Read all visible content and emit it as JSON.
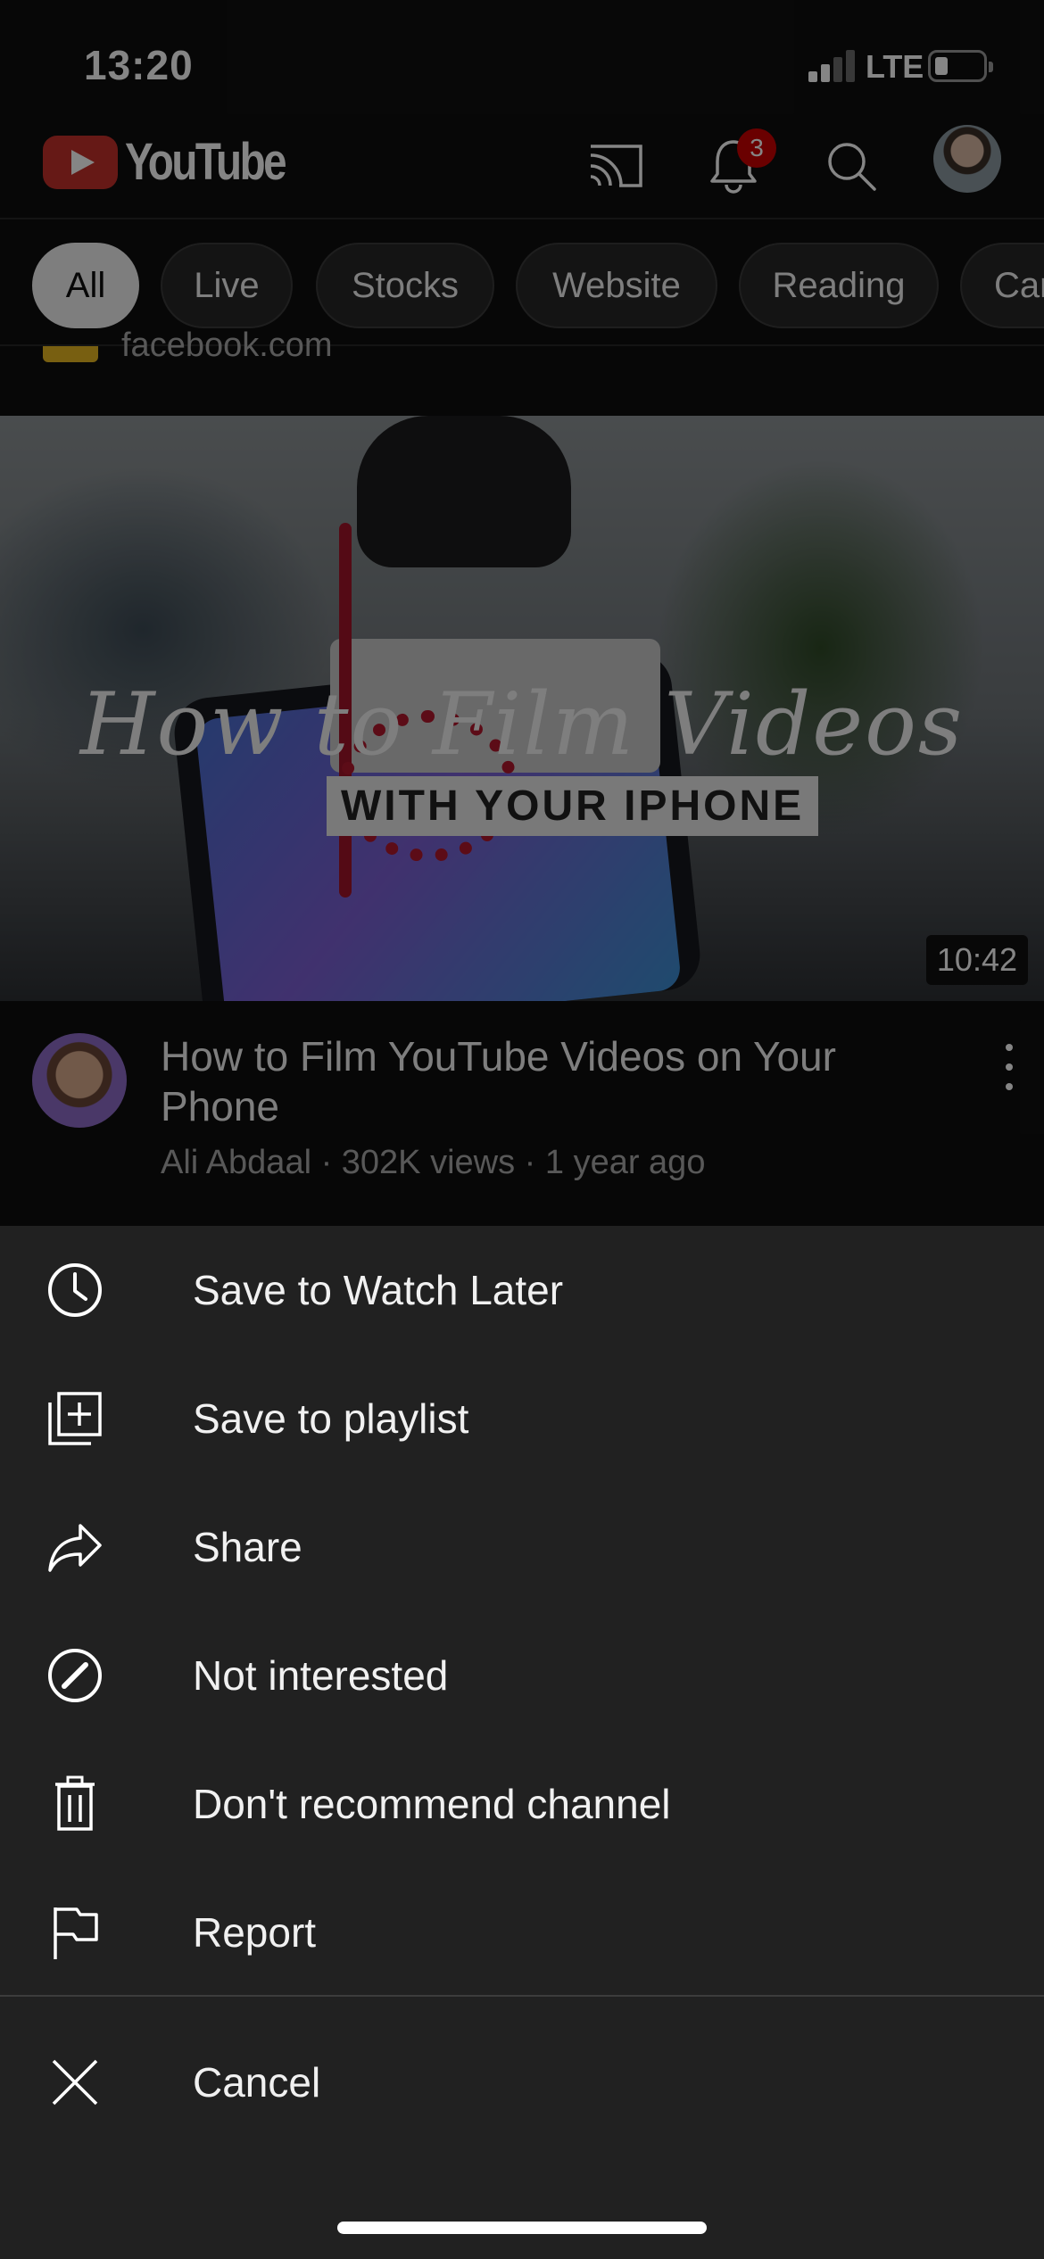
{
  "status_bar": {
    "time": "13:20",
    "network": "LTE"
  },
  "header": {
    "logo_text": "YouTube",
    "notification_count": "3",
    "icons": [
      "cast-icon",
      "bell-icon",
      "search-icon",
      "account-avatar"
    ]
  },
  "chips": [
    {
      "label": "All",
      "active": true
    },
    {
      "label": "Live"
    },
    {
      "label": "Stocks"
    },
    {
      "label": "Website"
    },
    {
      "label": "Reading"
    },
    {
      "label": "Car"
    }
  ],
  "previous_item": {
    "text": "facebook.com"
  },
  "video": {
    "thumbnail_title": "How to Film Videos",
    "thumbnail_subtitle": "WITH YOUR IPHONE",
    "duration": "10:42",
    "title": "How to Film YouTube Videos on Your Phone",
    "meta": "Ali Abdaal · 302K views · 1 year ago"
  },
  "menu": {
    "items": [
      {
        "label": "Save to Watch Later",
        "icon": "clock-icon"
      },
      {
        "label": "Save to playlist",
        "icon": "playlist-add-icon"
      },
      {
        "label": "Share",
        "icon": "share-icon"
      },
      {
        "label": "Not interested",
        "icon": "not-interested-icon"
      },
      {
        "label": "Don't recommend channel",
        "icon": "trash-icon"
      },
      {
        "label": "Report",
        "icon": "flag-icon"
      }
    ],
    "cancel_label": "Cancel"
  },
  "colors": {
    "brand_red": "#c4302b",
    "sheet_bg": "#212121",
    "page_bg": "#0f0f0f"
  }
}
